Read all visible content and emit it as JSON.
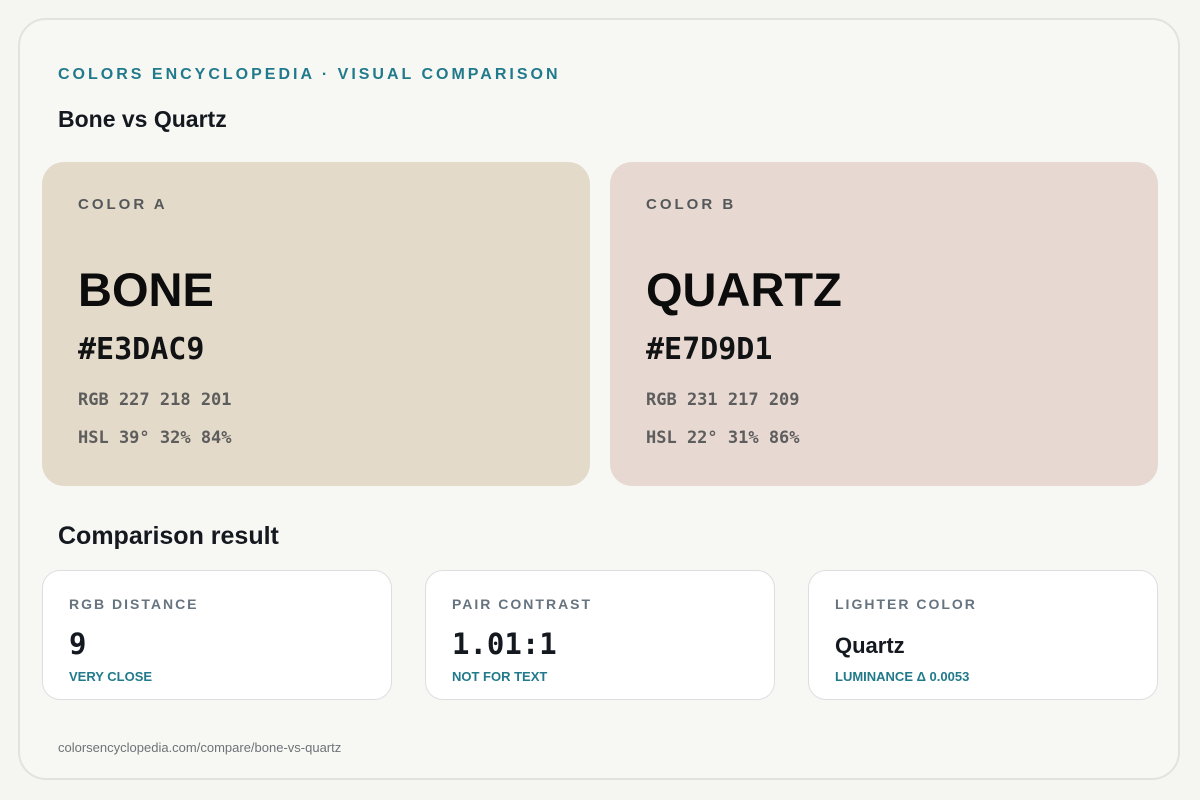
{
  "header": {
    "eyebrow": "COLORS ENCYCLOPEDIA · VISUAL COMPARISON",
    "title": "Bone vs Quartz"
  },
  "colors": {
    "a": {
      "label": "COLOR A",
      "name": "BONE",
      "hex": "#E3DAC9",
      "rgb": "RGB 227 218 201",
      "hsl": "HSL 39° 32% 84%",
      "swatch_color": "#E3DAC9"
    },
    "b": {
      "label": "COLOR B",
      "name": "QUARTZ",
      "hex": "#E7D9D1",
      "rgb": "RGB 231 217 209",
      "hsl": "HSL 22° 31% 86%",
      "swatch_color": "#E7D9D1"
    }
  },
  "comparison": {
    "title": "Comparison result",
    "metrics": [
      {
        "label": "RGB DISTANCE",
        "value": "9",
        "note": "VERY CLOSE"
      },
      {
        "label": "PAIR CONTRAST",
        "value": "1.01:1",
        "note": "NOT FOR TEXT"
      },
      {
        "label": "LIGHTER COLOR",
        "value": "Quartz",
        "note": "LUMINANCE Δ 0.0053"
      }
    ]
  },
  "footer": {
    "url": "colorsencyclopedia.com/compare/bone-vs-quartz"
  },
  "theme": {
    "accent": "#217a8c",
    "text_dark": "#14181f",
    "page_bg": "#f7f7f3"
  }
}
